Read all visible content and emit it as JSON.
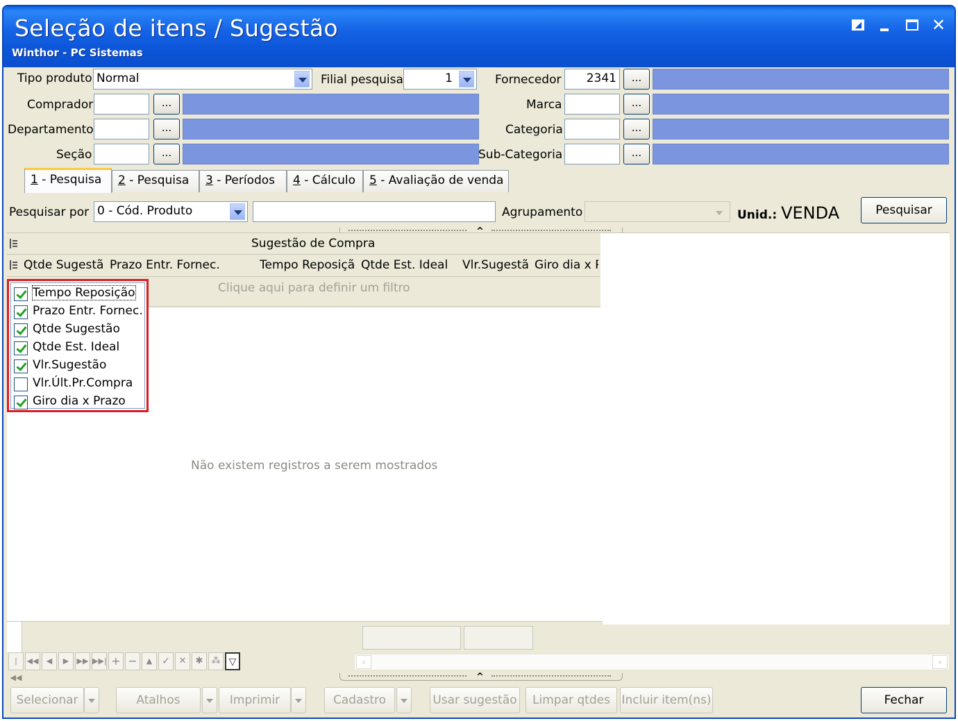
{
  "window": {
    "title": "Seleção de itens / Sugestão",
    "subtitle": "Winthor - PC Sistemas"
  },
  "filters": {
    "tipo_produto_label": "Tipo produto",
    "tipo_produto_value": "Normal",
    "filial_label": "Filial pesquisa",
    "filial_value": "1",
    "fornecedor_label": "Fornecedor",
    "fornecedor_value": "2341",
    "comprador_label": "Comprador",
    "marca_label": "Marca",
    "departamento_label": "Departamento",
    "categoria_label": "Categoria",
    "secao_label": "Seção",
    "subcategoria_label": "Sub-Categoria",
    "ellipsis": "..."
  },
  "tabs": [
    {
      "key": "1",
      "label": " - Pesquisa"
    },
    {
      "key": "2",
      "label": " - Pesquisa"
    },
    {
      "key": "3",
      "label": " - Períodos"
    },
    {
      "key": "4",
      "label": " - Cálculo"
    },
    {
      "key": "5",
      "label": " - Avaliação de venda"
    }
  ],
  "search": {
    "pesquisar_por_label": "Pesquisar por",
    "pesquisar_por_value": "0 - Cód. Produto",
    "agrupamento_label": "Agrupamento",
    "unid_label": "Unid.:",
    "unid_value": "VENDA",
    "pesquisar_button": "Pesquisar"
  },
  "grid": {
    "band_title": "Sugestão de Compra",
    "columns": [
      "Qtde Sugestã",
      "Prazo Entr. Fornec.",
      "Tempo Reposiçã",
      "Qtde Est. Ideal",
      "Vlr.Sugestã",
      "Giro dia x P"
    ],
    "filter_hint": "Clique aqui para definir um filtro",
    "empty_message": "Não existem registros a serem mostrados"
  },
  "column_customizer": [
    {
      "label": "Tempo Reposição",
      "checked": true
    },
    {
      "label": "Prazo Entr. Fornec.",
      "checked": true
    },
    {
      "label": "Qtde Sugestão",
      "checked": true
    },
    {
      "label": "Qtde Est. Ideal",
      "checked": true
    },
    {
      "label": "Vlr.Sugestão",
      "checked": true
    },
    {
      "label": "Vlr.Últ.Pr.Compra",
      "checked": false
    },
    {
      "label": "Giro dia x Prazo",
      "checked": true
    }
  ],
  "bottom_buttons": {
    "selecionar": "Selecionar",
    "atalhos": "Atalhos",
    "imprimir": "Imprimir",
    "cadastro": "Cadastro",
    "usar_sugestao": "Usar sugestão",
    "limpar_qtdes": "Limpar qtdes",
    "incluir_itens": "Incluir item(ns)",
    "fechar": "Fechar"
  },
  "colors": {
    "title_bar": "#0c55d8",
    "description_field": "#7b96de",
    "highlight_border": "#e0181f",
    "window_bg": "#ece9d8"
  }
}
